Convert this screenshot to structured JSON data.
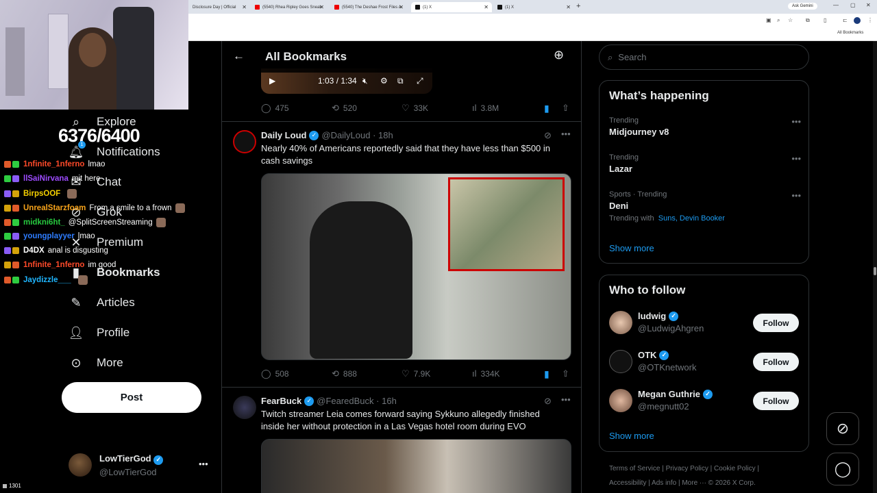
{
  "browser": {
    "tabs": [
      {
        "label": "Disclosure Day | Official",
        "icon": "youtube"
      },
      {
        "label": "(5540) Rhea Ripley Goes Sneak",
        "icon": "youtube"
      },
      {
        "label": "(5540) The Deshae Frost Files A",
        "icon": "youtube"
      },
      {
        "label": "(1) X",
        "icon": "x",
        "active": true
      },
      {
        "label": "(1) X",
        "icon": "x"
      }
    ],
    "new_tab": "+",
    "ask_gemini": "Ask Gemini",
    "all_bookmarks": "All Bookmarks"
  },
  "stream": {
    "counter": "6376/6400",
    "notification_badge": "1",
    "viewers": "1301",
    "chat": [
      {
        "user": "1nfinite_1nferno",
        "color": "#ff4a2a",
        "msg": "lmao",
        "emote": false
      },
      {
        "user": "llSaiNirvana",
        "color": "#9d4bff",
        "msg": "mit here",
        "emote": false
      },
      {
        "user": "BirpsOOF",
        "color": "#f5d000",
        "msg": "",
        "emote": true
      },
      {
        "user": "UnrealStarzfoam",
        "color": "#f7a31a",
        "msg": "From a smile to a frown",
        "emote": true
      },
      {
        "user": "midkni6ht_",
        "color": "#27c93f",
        "msg": "@SplitScreenStreaming",
        "emote": true
      },
      {
        "user": "youngplayyer",
        "color": "#2e7dff",
        "msg": "lmao",
        "emote": false
      },
      {
        "user": "D4DX",
        "color": "#ffffff",
        "msg": "anal is disgusting",
        "emote": false
      },
      {
        "user": "1nfinite_1nferno",
        "color": "#ff4a2a",
        "msg": "im good",
        "emote": false
      },
      {
        "user": "Jaydizzle___",
        "color": "#1fb6ff",
        "msg": "",
        "emote": true
      }
    ]
  },
  "nav": {
    "items": [
      {
        "label": "Explore",
        "icon": "search-icon"
      },
      {
        "label": "Notifications",
        "icon": "bell-icon"
      },
      {
        "label": "Chat",
        "icon": "chat-icon"
      },
      {
        "label": "Grok",
        "icon": "grok-icon"
      },
      {
        "label": "Premium",
        "icon": "premium-icon"
      },
      {
        "label": "Bookmarks",
        "icon": "bookmark-icon"
      },
      {
        "label": "Articles",
        "icon": "articles-icon"
      },
      {
        "label": "Profile",
        "icon": "person-icon"
      },
      {
        "label": "More",
        "icon": "more-circle-icon"
      }
    ],
    "post_label": "Post",
    "account": {
      "name": "LowTierGod",
      "handle": "@LowTierGod"
    }
  },
  "main": {
    "title": "All Bookmarks",
    "video": {
      "time": "1:03 / 1:34"
    },
    "tweets": [
      {
        "replies": "475",
        "reposts": "520",
        "likes": "33K",
        "views": "3.8M"
      },
      {
        "name": "Daily Loud",
        "handle": "@DailyLoud",
        "time": "18h",
        "text": "Nearly 40% of Americans reportedly said that they have less than $500 in cash savings",
        "replies": "508",
        "reposts": "888",
        "likes": "7.9K",
        "views": "334K"
      },
      {
        "name": "FearBuck",
        "handle": "@FearedBuck",
        "time": "16h",
        "text": "Twitch streamer Leia comes forward saying Sykkuno allegedly finished inside her without protection in a Las Vegas hotel room during EVO"
      }
    ]
  },
  "sidebar": {
    "search_placeholder": "Search",
    "happening_title": "What’s happening",
    "trends": [
      {
        "context": "Trending",
        "name": "Midjourney v8"
      },
      {
        "context": "Trending",
        "name": "Lazar"
      },
      {
        "context": "Sports · Trending",
        "name": "Deni",
        "with_label": "Trending with",
        "with_links": "Suns, Devin Booker"
      }
    ],
    "show_more": "Show more",
    "follow_title": "Who to follow",
    "follow": [
      {
        "name": "ludwig",
        "handle": "@LudwigAhgren",
        "button": "Follow"
      },
      {
        "name": "OTK",
        "handle": "@OTKnetwork",
        "button": "Follow"
      },
      {
        "name": "Megan Guthrie",
        "handle": "@megnutt02",
        "button": "Follow"
      }
    ],
    "footer_line1": "Terms of Service  |   Privacy Policy   |   Cookie Policy   |",
    "footer_line2": "Accessibility   |   Ads info   |   More ···   © 2026 X Corp."
  }
}
